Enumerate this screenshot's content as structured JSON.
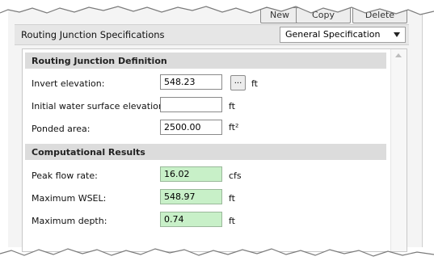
{
  "toolbar": {
    "new_label": "New",
    "copy_label": "Copy",
    "delete_label": "Delete"
  },
  "header": {
    "title": "Routing Junction Specifications",
    "dropdown_value": "General Specification"
  },
  "definition": {
    "title": "Routing Junction Definition",
    "invert_label": "Invert elevation:",
    "invert_value": "548.23",
    "invert_browse": "...",
    "invert_unit": "ft",
    "initial_wse_label": "Initial water surface elevation:",
    "initial_wse_value": "",
    "initial_wse_unit": "ft",
    "ponded_label": "Ponded area:",
    "ponded_value": "2500.00",
    "ponded_unit": "ft²"
  },
  "results": {
    "title": "Computational Results",
    "peak_label": "Peak flow rate:",
    "peak_value": "16.02",
    "peak_unit": "cfs",
    "wsel_label": "Maximum WSEL:",
    "wsel_value": "548.97",
    "wsel_unit": "ft",
    "depth_label": "Maximum depth:",
    "depth_value": "0.74",
    "depth_unit": "ft"
  }
}
